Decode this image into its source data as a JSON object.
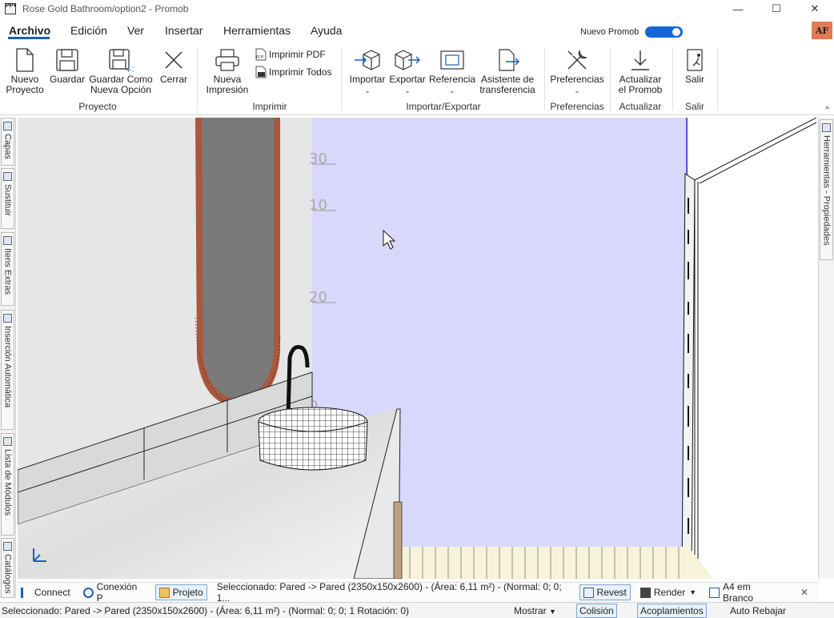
{
  "window": {
    "title": "Rose Gold Bathroom/option2 - Promob",
    "logo_text": "PP+",
    "controls": [
      "—",
      "☐",
      "✕"
    ]
  },
  "menu": {
    "tabs": [
      "Archivo",
      "Edición",
      "Ver",
      "Insertar",
      "Herramientas",
      "Ayuda"
    ],
    "active_tab": "Archivo",
    "new_promob_label": "Nuevo Promob",
    "new_promob_on": true,
    "avatar_initials": "AF"
  },
  "ribbon": {
    "proyecto": {
      "label": "Proyecto",
      "buttons": [
        "Nuevo Proyecto",
        "Guardar",
        "Guardar Como Nueva Opción",
        "Cerrar"
      ]
    },
    "imprimir": {
      "label": "Imprimir",
      "new_print": "Nueva Impresión",
      "print_pdf": "Imprimir PDF",
      "print_all": "Imprimir Todos"
    },
    "importar_exportar": {
      "label": "Importar/Exportar",
      "buttons": [
        "Importar",
        "Exportar",
        "Referencia",
        "Asistente de transferencia"
      ]
    },
    "preferencias": {
      "label": "Preferencias",
      "button": "Preferencias"
    },
    "actualizar": {
      "label": "Actualizar",
      "button": "Actualizar el Promob"
    },
    "salir": {
      "label": "Salir",
      "button": "Salir"
    }
  },
  "left_rail": [
    "Capas",
    "Sustituir",
    "Itens Extras",
    "Inserción Automática",
    "Lista de Módulos",
    "Catálogos"
  ],
  "right_rail": [
    "Herramientas - Propiedades"
  ],
  "viewport": {
    "dimension_marks": [
      "30",
      "10",
      "20",
      "0"
    ]
  },
  "bottom_bar": {
    "connect": "Connect",
    "conexion": "Conexión P",
    "projeto": "Projeto",
    "selection": "Seleccionado: Pared -> Pared (2350x150x2600) - (Área: 6,11 m²) - (Normal: 0; 0; 1...",
    "revest": "Revest",
    "render": "Render",
    "a4": "A4 em Branco",
    "close": "✕"
  },
  "status_bar": {
    "text": "Seleccionado: Pared -> Pared (2350x150x2600) - (Área: 6,11 m²) - (Normal: 0; 0; 1 Rotación: 0)",
    "mostrar": "Mostrar",
    "colision": "Colisión",
    "acoplamientos": "Acoplamientos",
    "auto_rebajar": "Auto Rebajar"
  },
  "colors": {
    "accent": "#1f5fb4",
    "toggle": "#1565d8",
    "avatar": "#e07b54",
    "back_wall": "#d8d8fd"
  }
}
